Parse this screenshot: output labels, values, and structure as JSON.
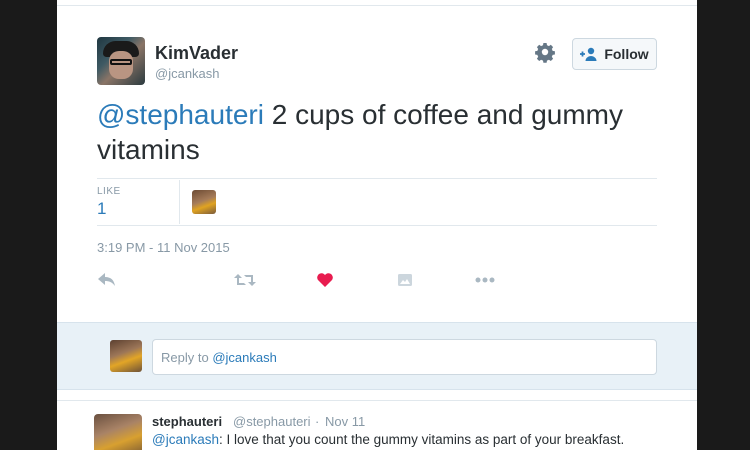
{
  "tweet": {
    "author_name": "KimVader",
    "author_handle": "@jcankash",
    "follow_label": "Follow",
    "mention": "@stephauteri",
    "text": " 2 cups of coffee and gummy vitamins",
    "like_label": "LIKE",
    "like_count": "1",
    "timestamp": "3:19 PM - 11 Nov 2015"
  },
  "actions": [
    "reply-icon",
    "retweet-icon",
    "heart-icon",
    "image-icon",
    "more-icon"
  ],
  "colors": {
    "accent": "#2b7bb9",
    "heart": "#e81c4f",
    "muted": "#8899a6",
    "text": "#292f33"
  },
  "reply_box": {
    "prefix": "Reply to ",
    "mention": "@jcankash"
  },
  "reply_tweet": {
    "name": "stephauteri",
    "handle": "@stephauteri",
    "separator": "·",
    "date": "Nov 11",
    "mention": "@jcankash",
    "text": ": I love that you count the gummy vitamins as part of your breakfast."
  }
}
